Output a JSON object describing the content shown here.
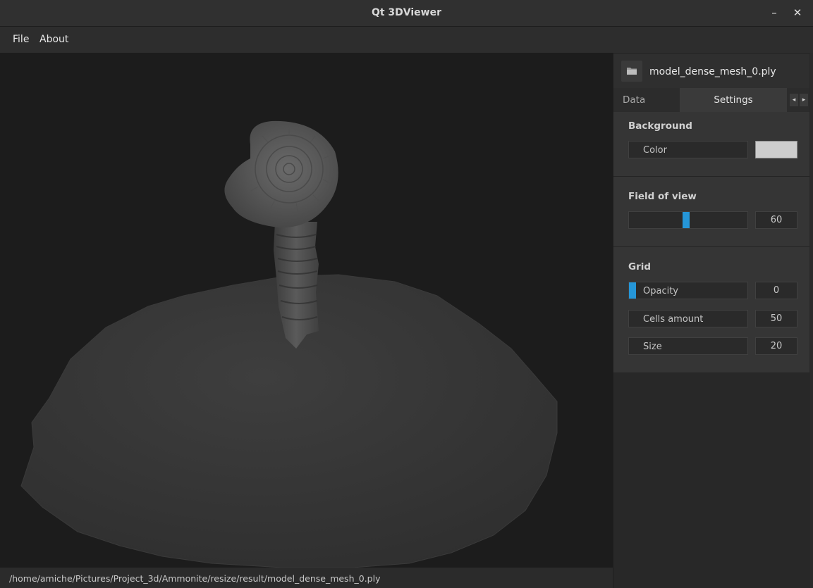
{
  "window": {
    "title": "Qt 3DViewer",
    "minimize_label": "–",
    "close_label": "✕"
  },
  "menu": {
    "items": [
      "File",
      "About"
    ]
  },
  "status": {
    "path": "/home/amiche/Pictures/Project_3d/Ammonite/resize/result/model_dense_mesh_0.ply"
  },
  "panel": {
    "file": {
      "name": "model_dense_mesh_0.ply",
      "icon": "folder-icon"
    },
    "tabs": [
      {
        "label": "Data"
      },
      {
        "label": "Settings"
      }
    ],
    "active_tab": "Settings",
    "background": {
      "title": "Background",
      "color_label": "Color",
      "color_value": "#cdcdcd"
    },
    "fov": {
      "title": "Field of view",
      "value": "60",
      "slider_fraction": 0.45
    },
    "grid": {
      "title": "Grid",
      "opacity": {
        "label": "Opacity",
        "value": "0",
        "fraction": 0
      },
      "cells": {
        "label": "Cells amount",
        "value": "50"
      },
      "size": {
        "label": "Size",
        "value": "20"
      }
    }
  },
  "colors": {
    "accent": "#2596d8",
    "viewport_bg": "#1c1c1c",
    "panel_bg": "#353535"
  }
}
